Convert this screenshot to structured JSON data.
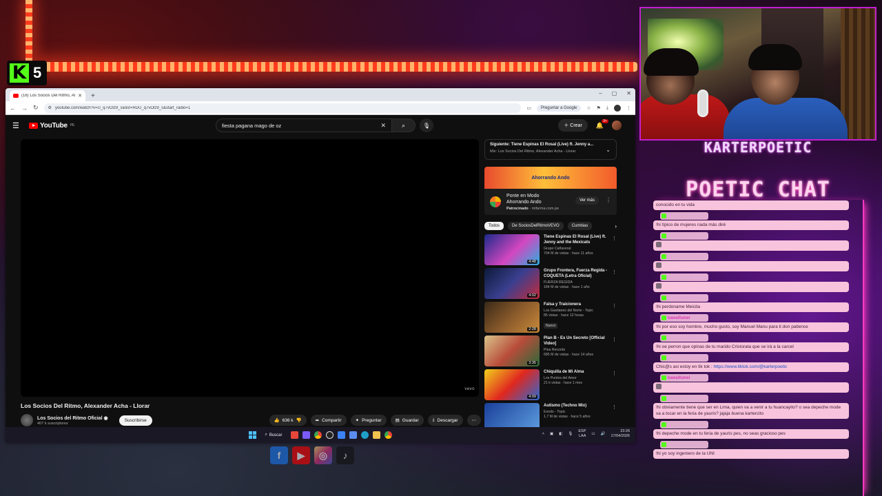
{
  "overlay": {
    "kick_badge_number": "5",
    "streamer_name": "KARTERPOETIC",
    "chat_title": "POETIC CHAT"
  },
  "browser": {
    "tab_title": "(16) Los Socios Del Ritmo, Ale",
    "new_tab": "+",
    "url": "youtube.com/watch?v=U_q7vOlz9_s&list=RDU_q7vOlz9_s&start_radio=1",
    "ask_google": "Preguntar a Google",
    "win_min": "–",
    "win_max": "▢",
    "win_close": "✕"
  },
  "youtube": {
    "logo": "YouTube",
    "logo_region": "PE",
    "search_query": "fiesta pagana mago de oz",
    "create_label": "Crear",
    "notif_count": "9+",
    "player_brand": "vevo",
    "video_title": "Los Socios Del Ritmo, Alexander Acha - Llorar",
    "channel_name": "Los Socios del Ritmo Oficial",
    "channel_subs": "407 k suscriptores",
    "subscribe_label": "Suscribirse",
    "likes": "636 k",
    "share_label": "Compartir",
    "ask_label": "Preguntar",
    "save_label": "Guardar",
    "download_label": "Descargar",
    "next_up": "Siguiente: Tiene Espinas El Rosal (Live) ft. Jenny a...",
    "next_mix": "Mix: Los Socios Del Ritmo, Alexander Acha - Llorar",
    "ad_banner": "Ahorrando Ando",
    "ad_title": "Ponte en Modo Ahorrando Ando",
    "ad_sponsored": "Patrocinado",
    "ad_domain": "mifarma.com.pe",
    "ad_cta": "Ver más",
    "chips": [
      "Todos",
      "De SociosDelRitmoVEVO",
      "Cumbias"
    ],
    "related": [
      {
        "title": "Tiene Espinas El Rosal (Live) ft. Jenny and the Mexicats",
        "channel": "Grupo Cañaveral",
        "meta": "704 M de vistas · hace 11 años",
        "duration": "4:48",
        "badge": ""
      },
      {
        "title": "Grupo Frontera, Fuerza Regida - COQUETA (Letra Oficial)",
        "channel": "FUERZA REGIDA",
        "meta": "184 M de vistas · hace 1 año",
        "duration": "4:02",
        "badge": ""
      },
      {
        "title": "Falsa y Traicionera",
        "channel": "Los Gavilanes del Norte - Topic",
        "meta": "85 vistas · hace 12 horas",
        "duration": "2:28",
        "badge": "Nuevo"
      },
      {
        "title": "Plan B - Es Un Secreto [Official Video]",
        "channel": "Pina Records",
        "meta": "685 M de vistas · hace 14 años",
        "duration": "3:35",
        "badge": ""
      },
      {
        "title": "Chiquilla de Mi Alma",
        "channel": "Los Puntos del Amor",
        "meta": "21 k vistas · hace 1 mes",
        "duration": "4:09",
        "badge": ""
      },
      {
        "title": "Autismo (Techno Mix)",
        "channel": "Exodo - Topic",
        "meta": "1.7 M de vistas · hace 5 años",
        "duration": "",
        "badge": ""
      }
    ]
  },
  "taskbar": {
    "search_label": "Buscar",
    "lang": "ESP",
    "lang_sub": "LAA",
    "time": "23:26",
    "date": "17/04/2026"
  },
  "chat": {
    "messages": [
      {
        "user": "",
        "text": "conocido en tu vida"
      },
      {
        "user": " ",
        "text": "!hi típico de mujeres nada más diré"
      },
      {
        "user": " ",
        "text": ""
      },
      {
        "user": " ",
        "text": ""
      },
      {
        "user": " ",
        "text": ""
      },
      {
        "user": " ",
        "text": "!hi perdoname Meicita"
      },
      {
        "user": "kawaifumei",
        "text": "!hi por eso soy hombre, mucho gusto, soy Manuel Manu para ti don patience"
      },
      {
        "user": " ",
        "text": "!hi oe perron que opinas de tu marido Cristorata que se irá a la carcel"
      },
      {
        "user": " ",
        "text": "Chic@s asi estoy en tik tok : ",
        "link": "https://www.tiktok.com/@karterpoetic"
      },
      {
        "user": "kawaifumei",
        "text": ""
      },
      {
        "user": " ",
        "text": "!hi obviamente tiene que ser en Lima, quien va a venir a tu huancayito? o sea depeche mode va a tocar en la feria de yauris? jajaja buena kartercito"
      },
      {
        "user": " ",
        "text": "!hi depeche mode en tu feria de yauris pes, no seas gracioso pes"
      },
      {
        "user": " ",
        "text": "!hi yo soy ingeniero de la UNI"
      }
    ]
  }
}
